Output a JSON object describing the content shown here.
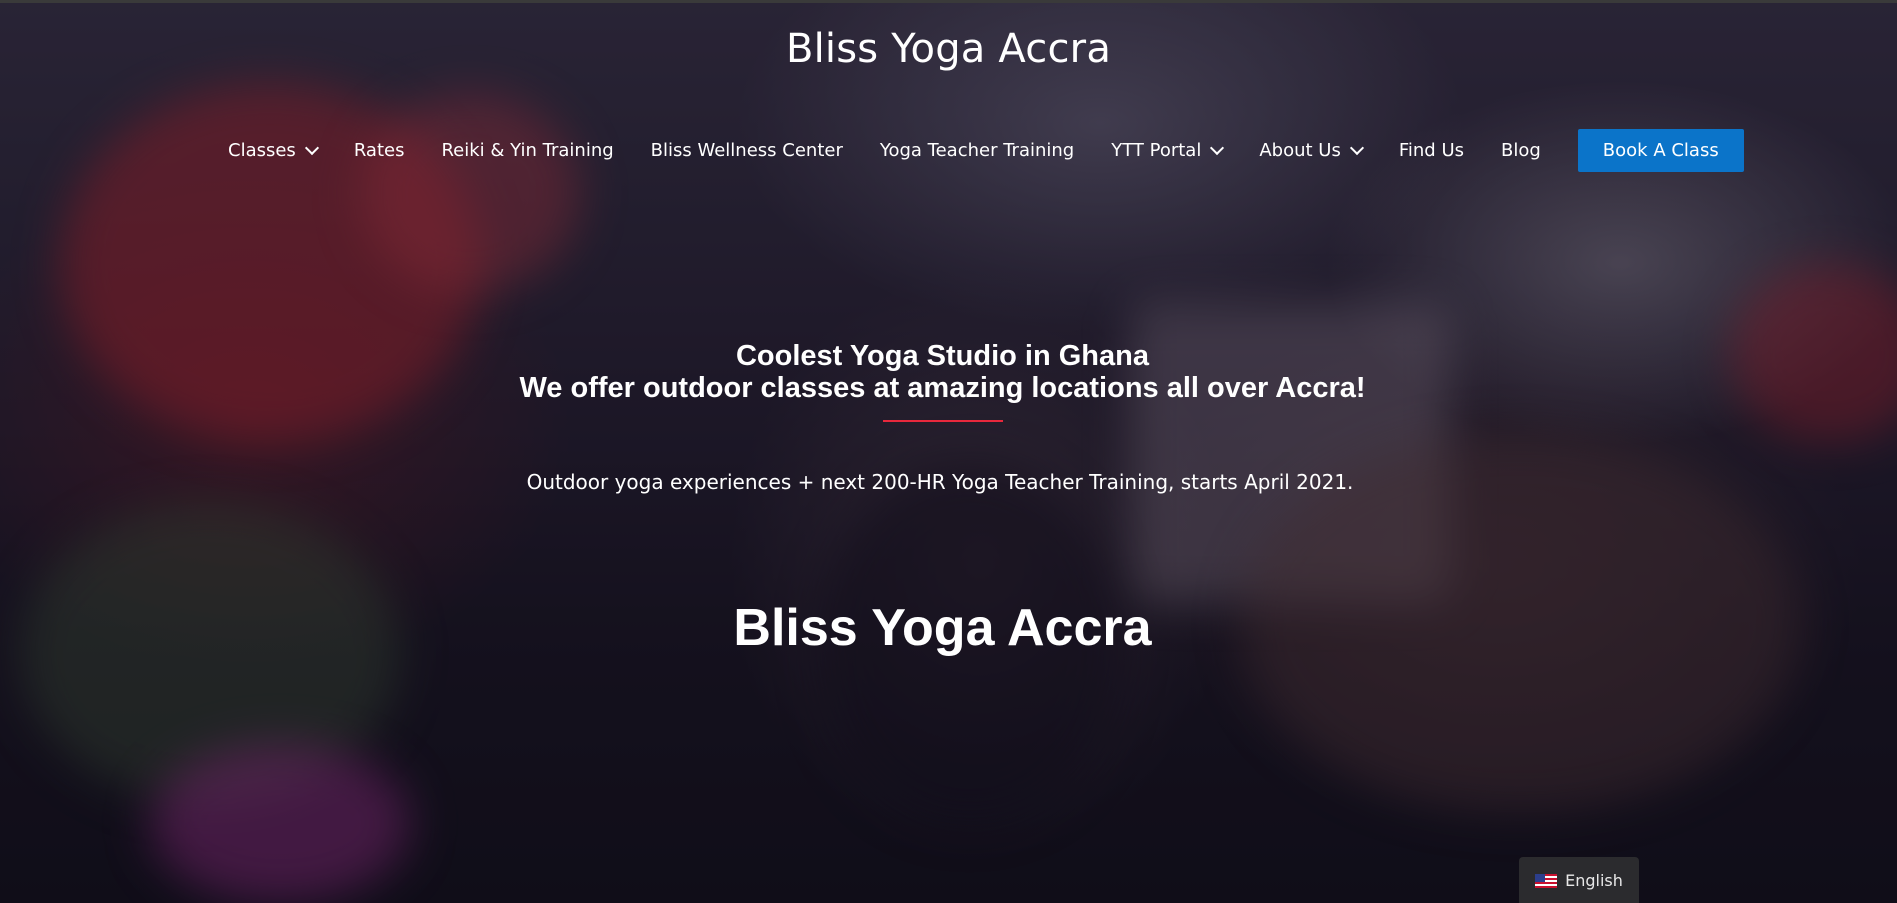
{
  "site": {
    "title": "Bliss Yoga Accra"
  },
  "nav": {
    "items": [
      {
        "label": "Classes",
        "dropdown": true
      },
      {
        "label": "Rates",
        "dropdown": false
      },
      {
        "label": "Reiki & Yin Training",
        "dropdown": false
      },
      {
        "label": "Bliss Wellness Center",
        "dropdown": false
      },
      {
        "label": "Yoga Teacher Training",
        "dropdown": false
      },
      {
        "label": "YTT Portal",
        "dropdown": true
      },
      {
        "label": "About Us",
        "dropdown": true
      },
      {
        "label": "Find Us",
        "dropdown": false
      },
      {
        "label": "Blog",
        "dropdown": false
      }
    ],
    "cta_label": "Book A Class"
  },
  "hero": {
    "headline_line1": "Coolest Yoga Studio in Ghana",
    "headline_line2": "We offer outdoor classes at amazing locations all over Accra!",
    "subtext": "Outdoor yoga experiences + next 200-HR Yoga Teacher Training, starts April 2021.",
    "big_title": "Bliss Yoga Accra"
  },
  "language_switcher": {
    "label": "English",
    "flag_icon": "us-flag-icon"
  },
  "colors": {
    "accent_blue": "#0b74c9",
    "divider_red": "#e8283c"
  }
}
